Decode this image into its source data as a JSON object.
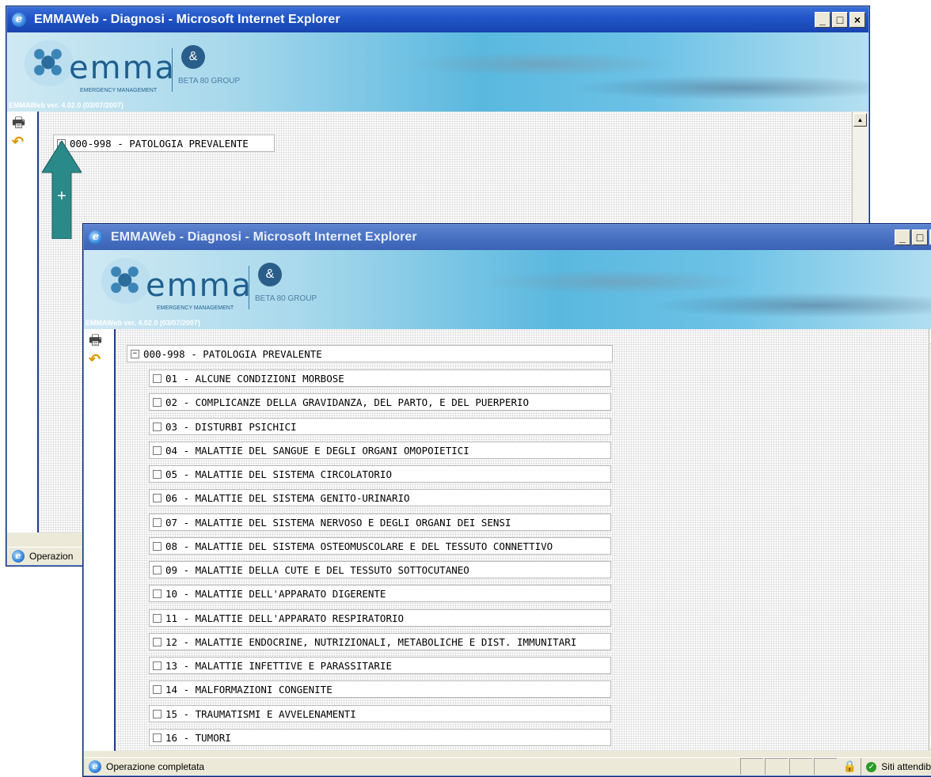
{
  "back_window": {
    "title": "EMMAWeb - Diagnosi - Microsoft Internet Explorer",
    "controls": [
      "_",
      "□",
      "×"
    ],
    "version": "EMMAWeb ver. 4.02.0 (03/07/2007)",
    "root_node": {
      "toggle": "+",
      "label": "000-998 - PATOLOGIA PREVALENTE"
    },
    "status": "Operazione completata",
    "status_visible": "Operazion"
  },
  "front_window": {
    "title": "EMMAWeb - Diagnosi - Microsoft Internet Explorer",
    "controls": [
      "_",
      "□",
      "×"
    ],
    "version": "EMMAWeb ver. 4.02.0 (03/07/2007)",
    "root_node": {
      "toggle": "−",
      "label": "000-998 - PATOLOGIA PREVALENTE"
    },
    "children": [
      "01 - ALCUNE CONDIZIONI MORBOSE",
      "02 - COMPLICANZE DELLA GRAVIDANZA, DEL PARTO, E DEL PUERPERIO",
      "03 - DISTURBI PSICHICI",
      "04 - MALATTIE DEL SANGUE E DEGLI ORGANI OMOPOIETICI",
      "05 - MALATTIE DEL SISTEMA CIRCOLATORIO",
      "06 - MALATTIE DEL SISTEMA GENITO-URINARIO",
      "07 - MALATTIE DEL SISTEMA NERVOSO E DEGLI ORGANI DEI SENSI",
      "08 - MALATTIE DEL SISTEMA OSTEOMUSCOLARE E DEL TESSUTO CONNETTIVO",
      "09 - MALATTIE DELLA CUTE E DEL TESSUTO SOTTOCUTANEO",
      "10 - MALATTIE DELL'APPARATO DIGERENTE",
      "11 - MALATTIE DELL'APPARATO RESPIRATORIO",
      "12 - MALATTIE ENDOCRINE, NUTRIZIONALI, METABOLICHE E DIST. IMMUNITARI",
      "13 - MALATTIE INFETTIVE E PARASSITARIE",
      "14 - MALFORMAZIONI CONGENITE",
      "15 - TRAUMATISMI E AVVELENAMENTI",
      "16 - TUMORI"
    ],
    "status": "Operazione completata",
    "zone": "Siti attendibili"
  },
  "branding": {
    "word": "emma",
    "sub": "EMERGENCY MANAGEMENT",
    "partner": "BETA 80 GROUP",
    "partner_mark": "&"
  },
  "annotation": {
    "symbol": "+"
  },
  "icons": {
    "ie": "ie-logo-icon",
    "print": "printer-icon",
    "back": "back-arrow-icon",
    "lock": "lock-icon",
    "zone": "trusted-zone-icon"
  },
  "colors": {
    "titlebar_active": "#2156c8",
    "titlebar_inactive": "#4a73c4",
    "annotation_arrow": "#2a8a8a",
    "banner": "#5ab8df"
  }
}
